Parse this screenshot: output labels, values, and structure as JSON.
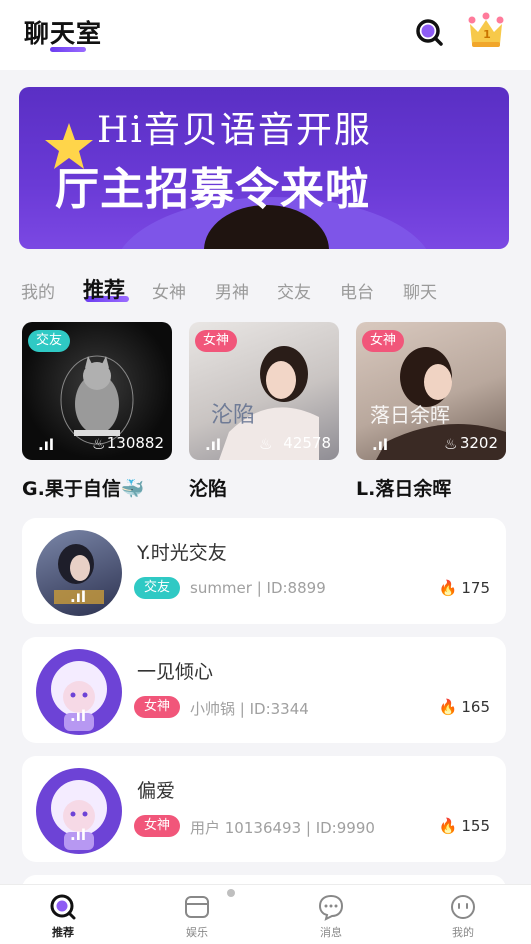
{
  "header": {
    "title": "聊天室",
    "crown_badge": "1"
  },
  "banner": {
    "line1": "Hi音贝语音开服",
    "line2": "厅主招募令来啦"
  },
  "tabs": [
    {
      "label": "我的"
    },
    {
      "label": "推荐"
    },
    {
      "label": "女神"
    },
    {
      "label": "男神"
    },
    {
      "label": "交友"
    },
    {
      "label": "电台"
    },
    {
      "label": "聊天"
    }
  ],
  "cards": [
    {
      "tag": "交友",
      "count": "130882",
      "name": "G.果于自信🐳",
      "tag_color": "#2fc9c4"
    },
    {
      "tag": "女神",
      "count": "42578",
      "name": "沦陷",
      "tag_color": "#f1567a"
    },
    {
      "tag": "女神",
      "count": "3202",
      "name": "L.落日余晖",
      "tag_color": "#f1567a"
    }
  ],
  "rooms": [
    {
      "title": "Y.时光交友",
      "tag": "交友",
      "meta": "summer  |  ID:8899",
      "heat": "175",
      "tag_color": "#2fc9c4"
    },
    {
      "title": "一见倾心",
      "tag": "女神",
      "meta": "小帅锅  |  ID:3344",
      "heat": "165",
      "tag_color": "#f1567a"
    },
    {
      "title": "偏爱",
      "tag": "女神",
      "meta": "用户 10136493  |  ID:9990",
      "heat": "155",
      "tag_color": "#f1567a"
    }
  ],
  "nav": [
    {
      "label": "推荐",
      "icon": "recommend-icon"
    },
    {
      "label": "娱乐",
      "icon": "entertainment-icon"
    },
    {
      "label": "消息",
      "icon": "message-icon"
    },
    {
      "label": "我的",
      "icon": "profile-icon"
    }
  ],
  "colors": {
    "accent": "#6b3cf0",
    "teal_tag": "#2fc9c4",
    "pink_tag": "#f1567a",
    "flame": "#f38a3c"
  }
}
